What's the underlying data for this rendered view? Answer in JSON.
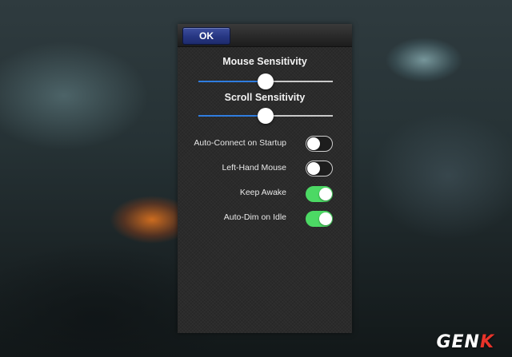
{
  "dialog": {
    "ok_label": "OK"
  },
  "mouse_sensitivity": {
    "title": "Mouse Sensitivity",
    "value": 0.5
  },
  "scroll_sensitivity": {
    "title": "Scroll Sensitivity",
    "value": 0.5
  },
  "toggles": [
    {
      "label": "Auto-Connect on Startup",
      "on": false
    },
    {
      "label": "Left-Hand Mouse",
      "on": false
    },
    {
      "label": "Keep Awake",
      "on": true
    },
    {
      "label": "Auto-Dim on Idle",
      "on": true
    }
  ],
  "colors": {
    "slider_active": "#2f7de0",
    "slider_inactive": "#c9c9c9",
    "toggle_on": "#4cd964",
    "ok_button": "#263682",
    "watermark_accent": "#e8332a"
  },
  "watermark": {
    "text_main": "GEN",
    "text_accent": "K"
  }
}
